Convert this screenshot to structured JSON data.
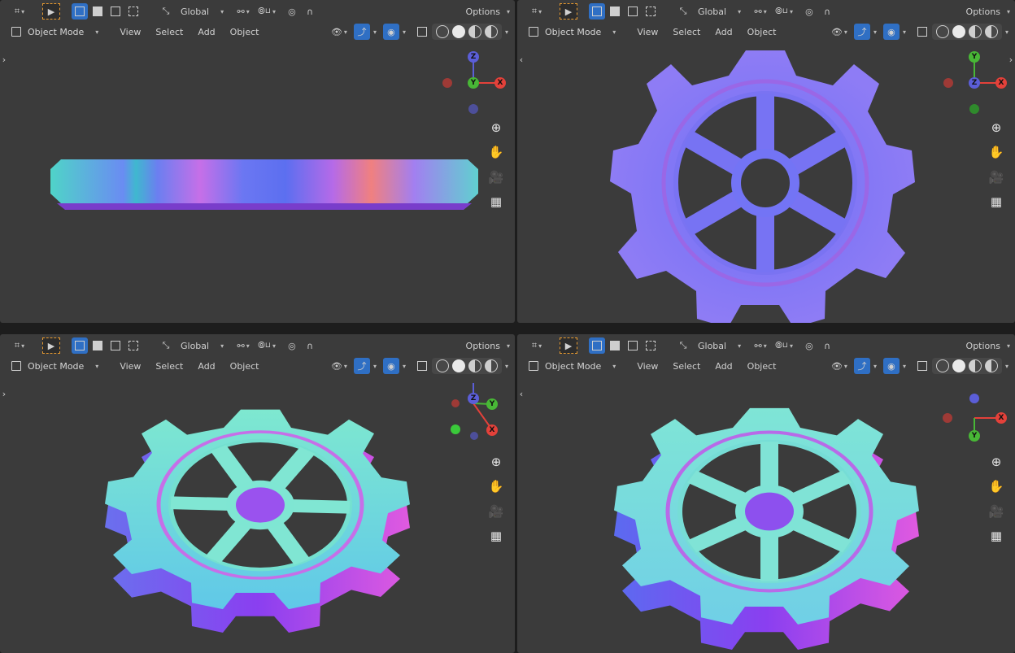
{
  "header": {
    "transform_orientation": "Global",
    "options_label": "Options",
    "mode_label": "Object Mode",
    "menu": [
      "View",
      "Select",
      "Add",
      "Object"
    ]
  },
  "viewports": [
    {
      "id": "top-left",
      "gizmo_axes": [
        "Z",
        "Y",
        "X"
      ]
    },
    {
      "id": "top-right",
      "gizmo_axes": [
        "Y",
        "Z",
        "X"
      ]
    },
    {
      "id": "bottom-left",
      "gizmo_axes": [
        "Z",
        "Y",
        "X"
      ]
    },
    {
      "id": "bottom-right",
      "gizmo_axes": [
        "X",
        "Y"
      ]
    }
  ],
  "icons": {
    "nav": [
      "zoom-icon",
      "pan-hand-icon",
      "camera-icon",
      "grid-perspective-icon"
    ]
  },
  "colors": {
    "axis_x": "#e3413a",
    "axis_y": "#48b736",
    "axis_z": "#5b5ed8",
    "active_tool": "#e79a30",
    "selected_blue": "#2f6fc4"
  }
}
